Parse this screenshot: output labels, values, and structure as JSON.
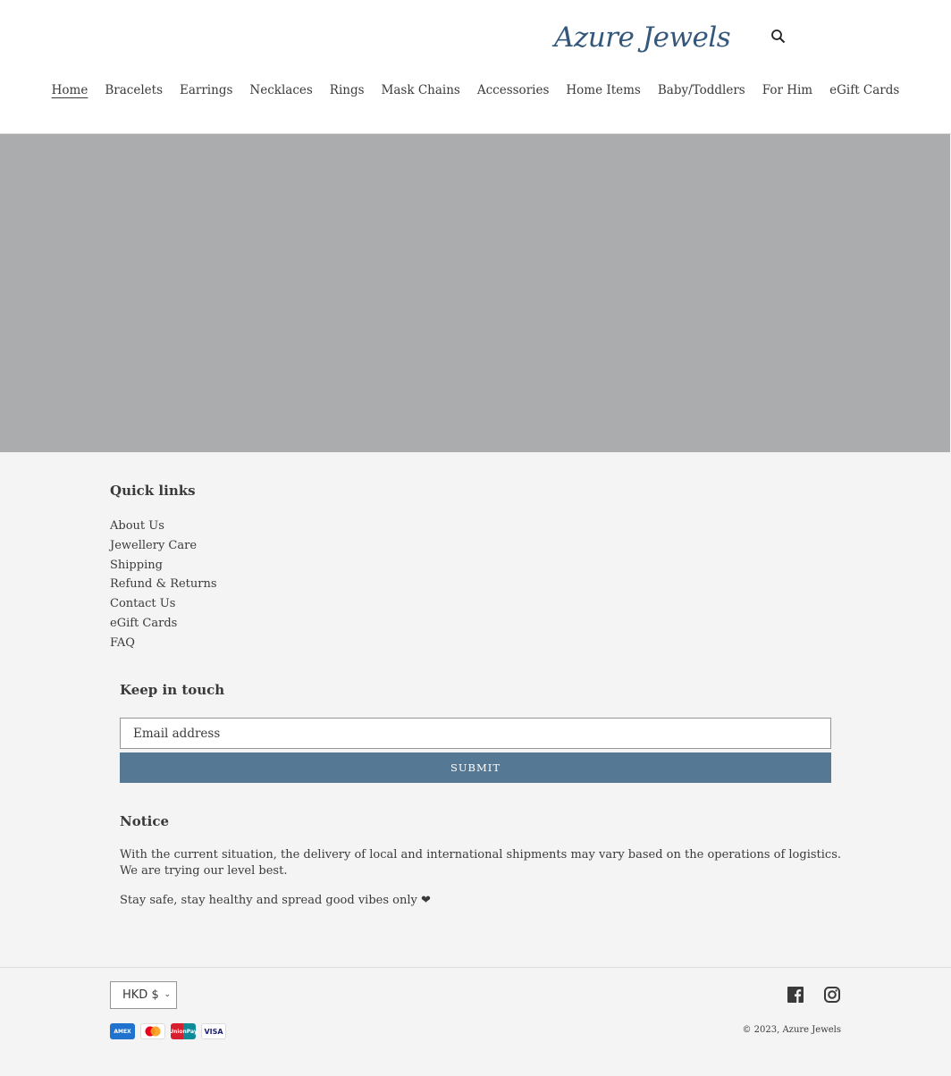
{
  "header": {
    "logo": "Azure Jewels",
    "search_icon": "search-icon"
  },
  "nav": [
    "Home",
    "Bracelets",
    "Earrings",
    "Necklaces",
    "Rings",
    "Mask Chains",
    "Accessories",
    "Home Items",
    "Baby/Toddlers",
    "For Him",
    "eGift Cards"
  ],
  "hero": {
    "color": "#abacae"
  },
  "footer": {
    "quick_links": {
      "title": "Quick links",
      "items": [
        "About Us",
        "Jewellery Care",
        "Shipping",
        "Refund & Returns",
        "Contact Us",
        "eGift Cards",
        "FAQ"
      ]
    },
    "newsletter": {
      "title": "Keep in touch",
      "placeholder": "Email address",
      "submit": "SUBMIT"
    },
    "notice": {
      "title": "Notice",
      "p1": "With the current situation, the delivery of local and international shipments may vary based on the operations of logistics. We are trying our level best.",
      "p2": "Stay safe, stay healthy and spread good vibes only ❤"
    },
    "currency": "HKD $",
    "payments": [
      "AMEX",
      "Mastercard",
      "UnionPay",
      "VISA"
    ],
    "social": [
      "facebook-icon",
      "instagram-icon"
    ],
    "copyright": "© 2023, Azure Jewels",
    "accent": "#557894"
  }
}
